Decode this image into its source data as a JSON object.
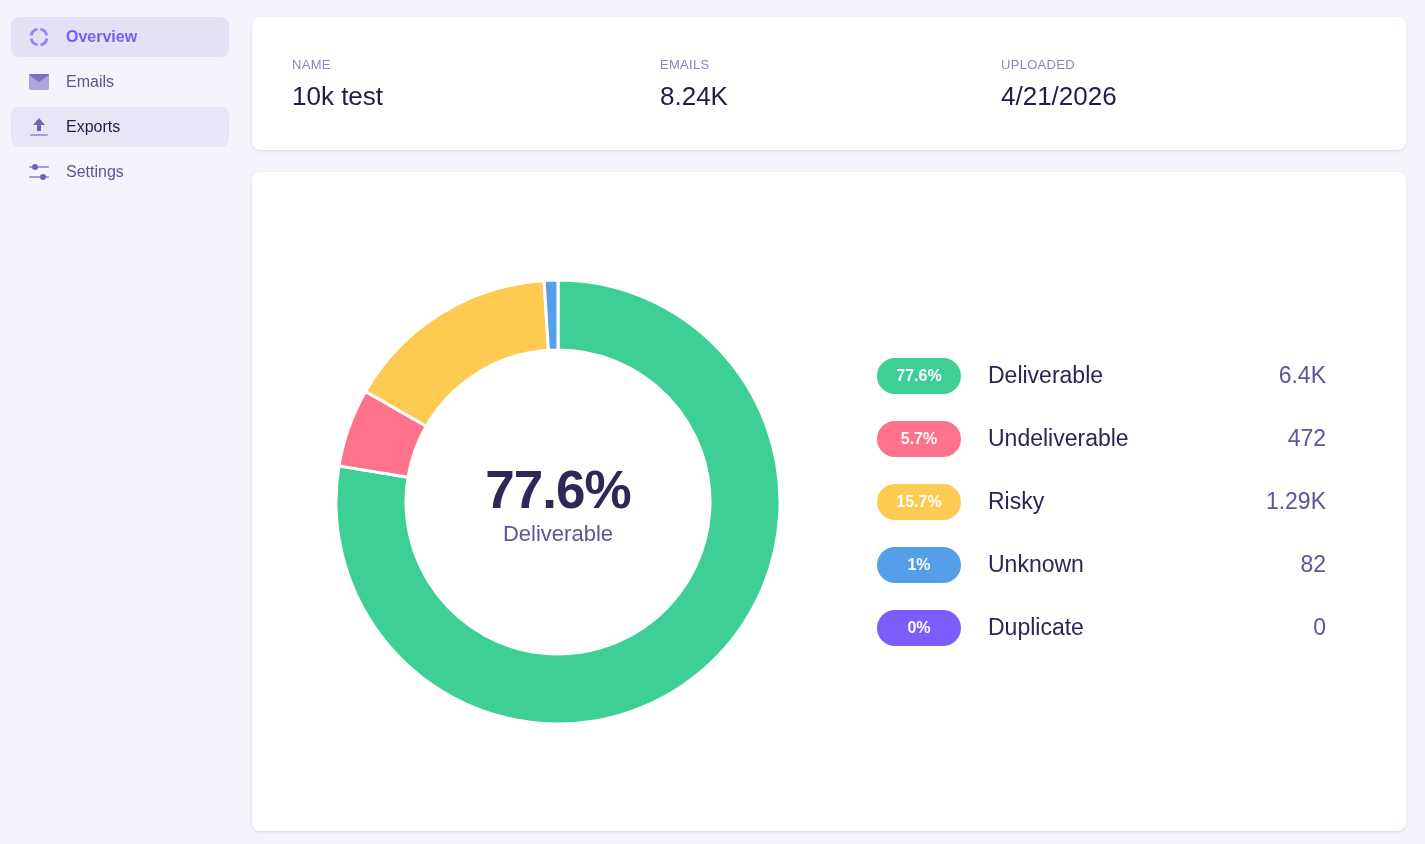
{
  "sidebar": {
    "items": [
      {
        "label": "Overview",
        "selected": true,
        "highlighted": false
      },
      {
        "label": "Emails",
        "selected": false,
        "highlighted": false
      },
      {
        "label": "Exports",
        "selected": false,
        "highlighted": true
      },
      {
        "label": "Settings",
        "selected": false,
        "highlighted": false
      }
    ]
  },
  "summary": {
    "fields": [
      {
        "label": "NAME",
        "value": "10k test"
      },
      {
        "label": "EMAILS",
        "value": "8.24K"
      },
      {
        "label": "UPLOADED",
        "value": "4/21/2026"
      }
    ]
  },
  "results": {
    "chart_data": {
      "type": "donut",
      "categories": [
        "Deliverable",
        "Undeliverable",
        "Risky",
        "Unknown",
        "Duplicate"
      ],
      "values": [
        77.6,
        5.7,
        15.7,
        1,
        0
      ]
    },
    "center": {
      "value": "77.6%",
      "label": "Deliverable"
    },
    "legend": [
      {
        "percent": "77.6%",
        "count": "6.4K",
        "color": "#3ecf96"
      },
      {
        "percent": "5.7%",
        "count": "472",
        "color": "#ff728c"
      },
      {
        "percent": "15.7%",
        "count": "1.29K",
        "color": "#fdcb52"
      },
      {
        "percent": "1%",
        "count": "82",
        "color": "#559fe8"
      },
      {
        "percent": "0%",
        "count": "0",
        "color": "#7c5cfa"
      }
    ]
  }
}
